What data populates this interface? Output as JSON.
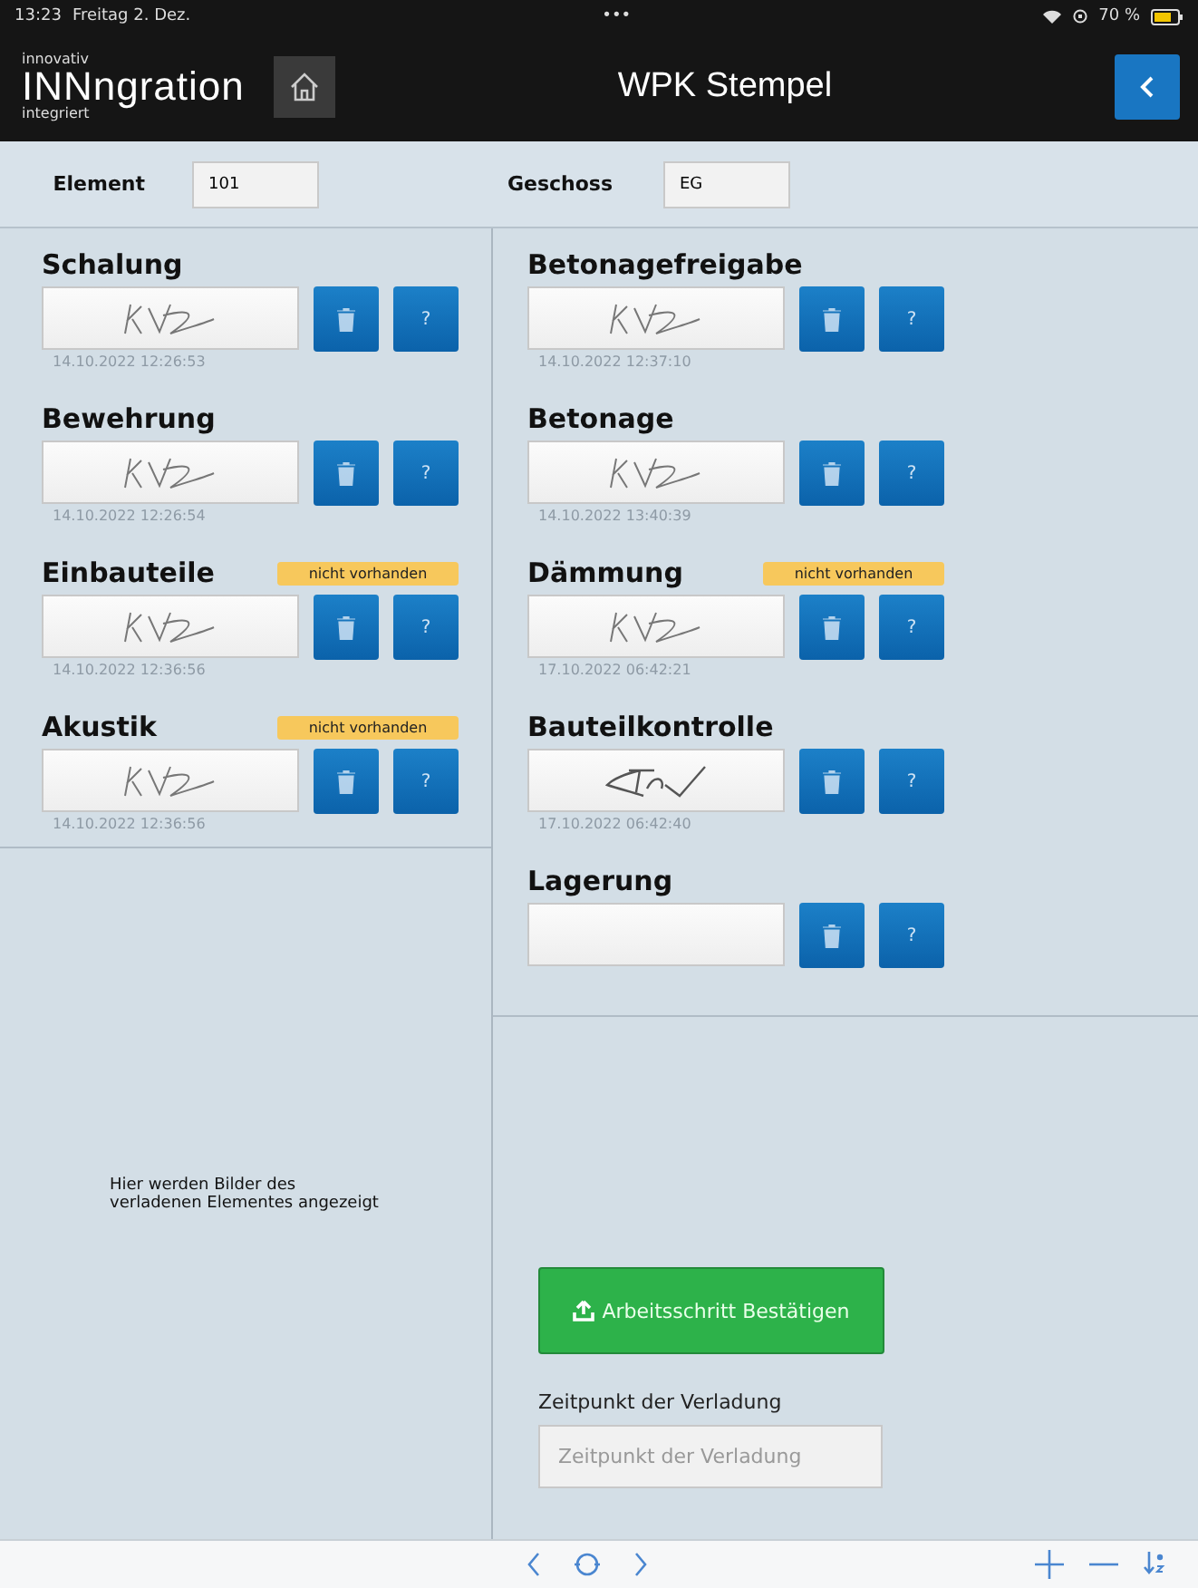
{
  "status_bar": {
    "time": "13:23",
    "date": "Freitag 2. Dez.",
    "dots": "•••",
    "battery_text": "70 %"
  },
  "header": {
    "logo_top": "innovativ",
    "logo_main": "INNngration",
    "logo_bottom": "integriert",
    "title": "WPK Stempel"
  },
  "fields": [
    {
      "label": "Element",
      "value": "101"
    },
    {
      "label": "Geschoss",
      "value": "EG"
    }
  ],
  "left_steps": [
    {
      "title": "Schalung",
      "kind": "initials",
      "timestamp": "14.10.2022 12:26:53",
      "help": "?"
    },
    {
      "title": "Bewehrung",
      "kind": "initials",
      "timestamp": "14.10.2022 12:26:54",
      "help": "?"
    },
    {
      "title": "Einbauteile",
      "badge": "nicht vorhanden",
      "kind": "initials",
      "timestamp": "14.10.2022 12:36:56",
      "help": "?"
    },
    {
      "title": "Akustik",
      "badge": "nicht vorhanden",
      "kind": "initials",
      "timestamp": "14.10.2022 12:36:56",
      "help": "?"
    }
  ],
  "right_steps": [
    {
      "title": "Betonagefreigabe",
      "kind": "initials",
      "timestamp": "14.10.2022 12:37:10",
      "help": "?"
    },
    {
      "title": "Betonage",
      "kind": "initials",
      "timestamp": "14.10.2022 13:40:39",
      "help": "?"
    },
    {
      "title": "Dämmung",
      "badge": "nicht vorhanden",
      "kind": "initials",
      "timestamp": "17.10.2022 06:42:21",
      "help": "?"
    },
    {
      "title": "Bauteilkontrolle",
      "kind": "stroke",
      "timestamp": "17.10.2022 06:42:40",
      "help": "?"
    },
    {
      "title": "Lagerung",
      "kind": "empty",
      "help": "?"
    }
  ],
  "images_note": "Hier werden Bilder des verladenen Elementes angezeigt",
  "confirm_button": "Arbeitsschritt Bestätigen",
  "loading_time": {
    "label": "Zeitpunkt der Verladung",
    "placeholder": "Zeitpunkt der Verladung"
  }
}
